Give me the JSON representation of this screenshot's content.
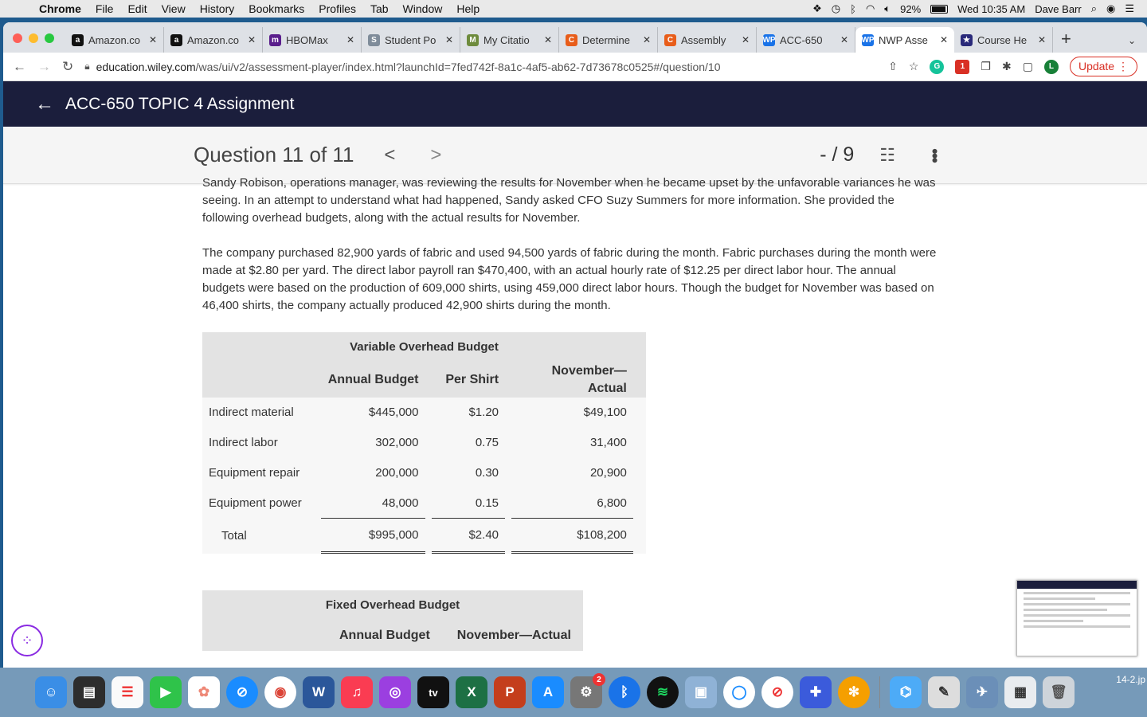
{
  "menubar": {
    "app": "Chrome",
    "items": [
      "File",
      "Edit",
      "View",
      "History",
      "Bookmarks",
      "Profiles",
      "Tab",
      "Window",
      "Help"
    ],
    "battery": "92%",
    "clock": "Wed 10:35 AM",
    "user": "Dave Barr"
  },
  "tabs": [
    {
      "title": "Amazon.co",
      "favicon": "a",
      "color": "#111111"
    },
    {
      "title": "Amazon.co",
      "favicon": "a",
      "color": "#111111"
    },
    {
      "title": "HBOMax",
      "favicon": "m",
      "color": "#5a1e8c"
    },
    {
      "title": "Student Po",
      "favicon": "S",
      "color": "#7f8c9a"
    },
    {
      "title": "My Citatio",
      "favicon": "M",
      "color": "#6e8b3d"
    },
    {
      "title": "Determine",
      "favicon": "C",
      "color": "#e85d1a"
    },
    {
      "title": "Assembly",
      "favicon": "C",
      "color": "#e85d1a"
    },
    {
      "title": "ACC-650",
      "favicon": "WP",
      "color": "#1a73e8"
    },
    {
      "title": "NWP Asse",
      "favicon": "WP",
      "color": "#1a73e8",
      "active": true
    },
    {
      "title": "Course He",
      "favicon": "★",
      "color": "#2a2a7a"
    }
  ],
  "address": {
    "domain": "education.wiley.com",
    "path": "/was/ui/v2/assessment-player/index.html?launchId=7fed742f-8a1c-4af5-ab62-7d73678c0525#/question/10",
    "update_label": "Update",
    "profile_initial": "L"
  },
  "app": {
    "title": "ACC-650 TOPIC 4 Assignment"
  },
  "question": {
    "title": "Question 11 of 11",
    "score": "- / 9",
    "paragraph1": "Sandy Robison, operations manager, was reviewing the results for November when he became upset by the unfavorable variances he was seeing. In an attempt to understand what had happened, Sandy asked CFO Suzy Summers for more information. She provided the following overhead budgets, along with the actual results for November.",
    "paragraph2": "The company purchased 82,900 yards of fabric and used 94,500 yards of fabric during the month. Fabric purchases during the month were made at $2.80 per yard. The direct labor payroll ran $470,400, with an actual hourly rate of $12.25 per direct labor hour. The annual budgets were based on the production of 609,000 shirts, using 459,000 direct labor hours. Though the budget for November was based on 46,400 shirts, the company actually produced 42,900 shirts during the month."
  },
  "variable_budget": {
    "title": "Variable Overhead Budget",
    "headers": [
      "Annual Budget",
      "Per Shirt",
      "November—Actual"
    ],
    "rows": [
      {
        "label": "Indirect material",
        "annual": "$445,000",
        "per_shirt": "$1.20",
        "actual": "$49,100"
      },
      {
        "label": "Indirect labor",
        "annual": "302,000",
        "per_shirt": "0.75",
        "actual": "31,400"
      },
      {
        "label": "Equipment repair",
        "annual": "200,000",
        "per_shirt": "0.30",
        "actual": "20,900"
      },
      {
        "label": "Equipment power",
        "annual": "48,000",
        "per_shirt": "0.15",
        "actual": "6,800"
      }
    ],
    "total": {
      "label": "Total",
      "annual": "$995,000",
      "per_shirt": "$2.40",
      "actual": "$108,200"
    }
  },
  "fixed_budget": {
    "title": "Fixed Overhead Budget",
    "headers": [
      "Annual Budget",
      "November—Actual"
    ]
  },
  "dock": {
    "filename": "14-2.jp",
    "badge": "2",
    "tv_label": "tv"
  }
}
